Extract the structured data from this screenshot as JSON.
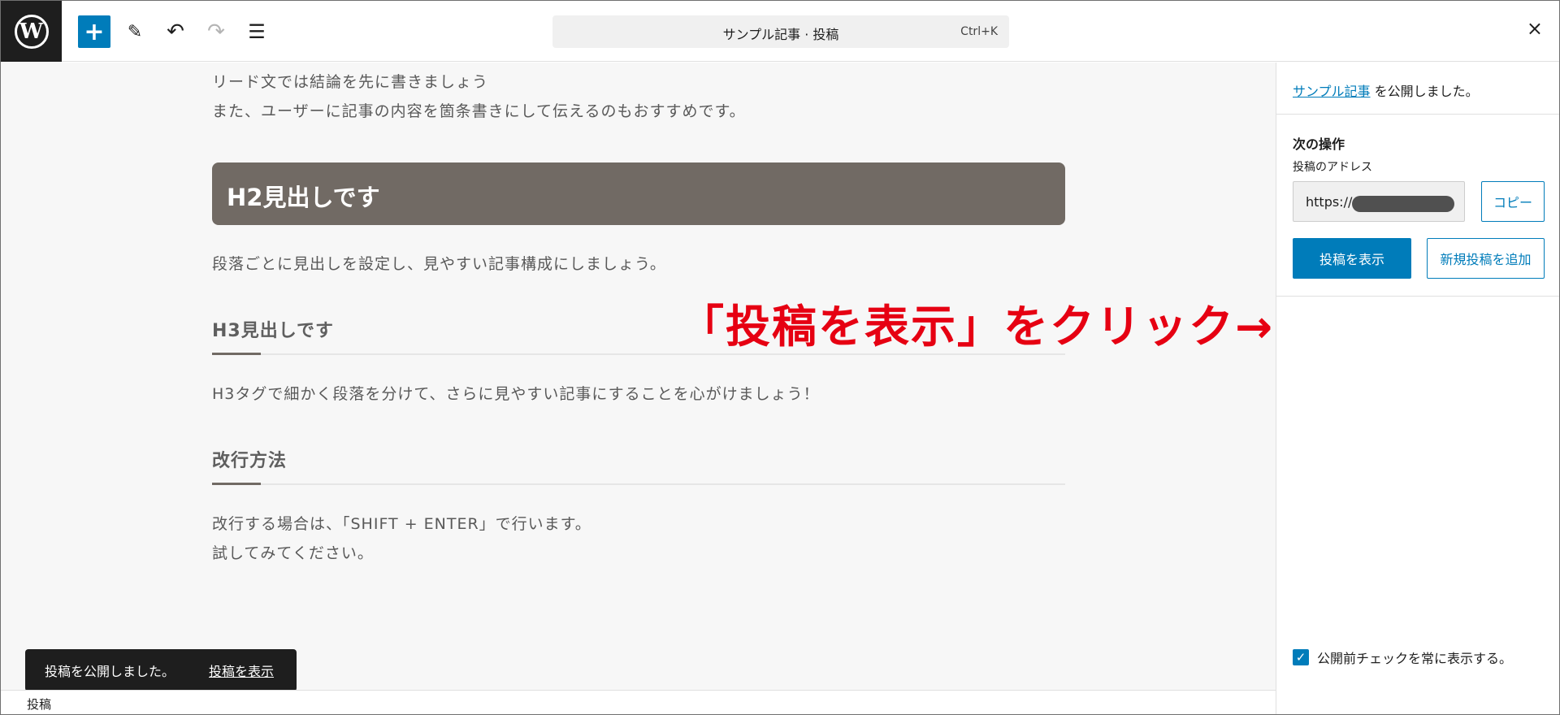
{
  "topbar": {
    "logo": "W",
    "add_icon": "plus-icon",
    "command": {
      "title": "サンプル記事 · 投稿",
      "shortcut": "Ctrl+K"
    },
    "close": "×"
  },
  "editor": {
    "lead_lines": [
      "リード文では結論を先に書きましょう",
      "また、ユーザーに記事の内容を箇条書きにして伝えるのもおすすめです。"
    ],
    "h2": "H2見出しです",
    "p2": "段落ごとに見出しを設定し、見やすい記事構成にしましょう。",
    "h3a": "H3見出しです",
    "p3": "H3タグで細かく段落を分けて、さらに見やすい記事にすることを心がけましょう！",
    "h3b": "改行方法",
    "p4_lines": [
      "改行する場合は、「SHIFT + ENTER」で行います。",
      "試してみてください。"
    ]
  },
  "annotation": "「投稿を表示」をクリック→",
  "snackbar": {
    "message": "投稿を公開しました。",
    "link": "投稿を表示"
  },
  "footer": {
    "breadcrumb": "投稿"
  },
  "sidebar": {
    "published_link": "サンプル記事",
    "published_suffix": " を公開しました。",
    "next_title": "次の操作",
    "address_label": "投稿のアドレス",
    "url_prefix": "https://",
    "copy_label": "コピー",
    "view_label": "投稿を表示",
    "new_label": "新規投稿を追加",
    "checkbox_label": "公開前チェックを常に表示する。"
  },
  "colors": {
    "accent": "#007cba",
    "heading_bg": "#716a64",
    "annotation": "#e60012"
  }
}
